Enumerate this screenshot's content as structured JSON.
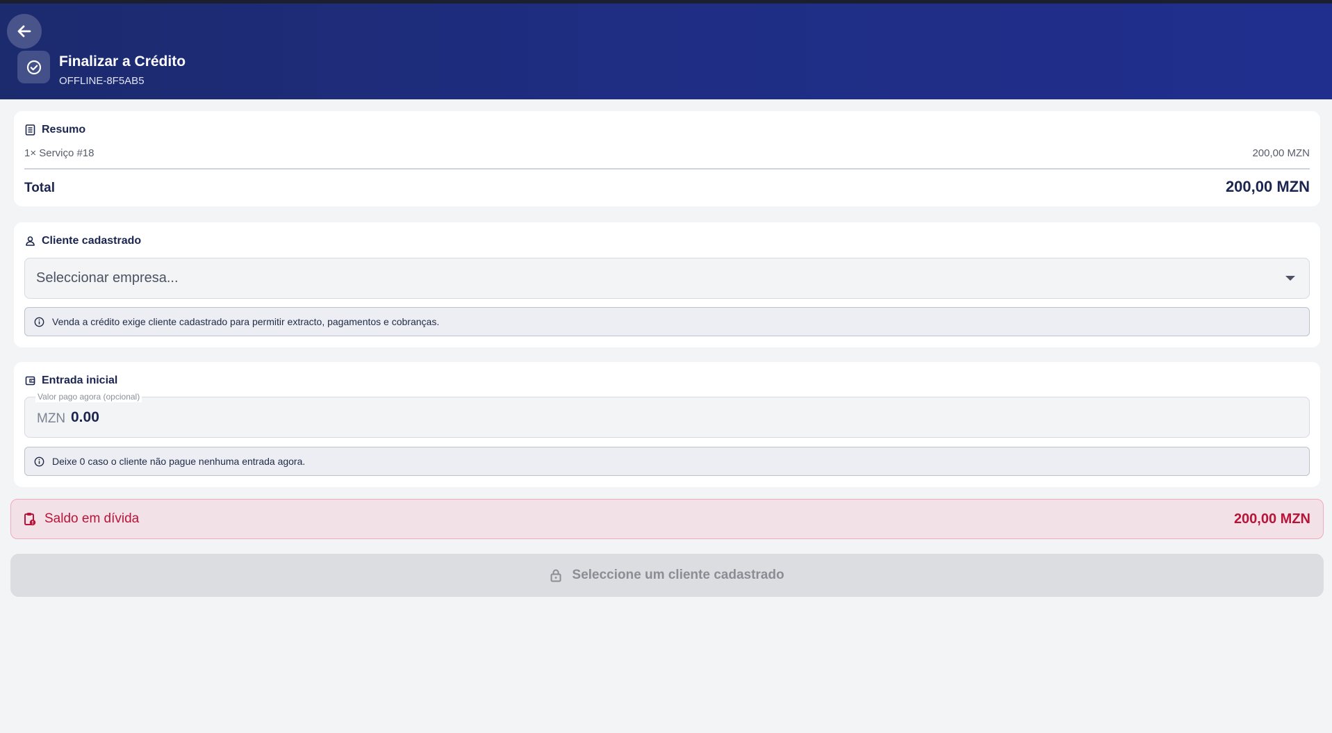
{
  "header": {
    "title": "Finalizar a Crédito",
    "subtitle": "OFFLINE-8F5AB5",
    "back_icon": "arrow-left-icon",
    "title_icon": "check-circle-icon",
    "gradient_start": "#1c2a6e",
    "gradient_end": "#202f8e"
  },
  "summary": {
    "title": "Resumo",
    "icon": "receipt-icon",
    "items": [
      {
        "label": "1× Serviço #18",
        "amount": "200,00 MZN"
      }
    ],
    "total_label": "Total",
    "total_value": "200,00 MZN"
  },
  "client": {
    "title": "Cliente cadastrado",
    "icon": "person-icon",
    "select_placeholder": "Seleccionar empresa...",
    "info_text": "Venda a crédito exige cliente cadastrado para permitir extracto, pagamentos e cobranças."
  },
  "down_payment": {
    "title": "Entrada inicial",
    "icon": "wallet-icon",
    "field_label": "Valor pago agora (opcional)",
    "currency_prefix": "MZN",
    "value": "0.00",
    "info_text": "Deixe 0 caso o cliente não pague nenhuma entrada agora."
  },
  "balance": {
    "label": "Saldo em dívida",
    "value": "200,00 MZN",
    "icon": "clipboard-alert-icon",
    "color": "#b8143a"
  },
  "submit": {
    "label": "Seleccione um cliente cadastrado",
    "icon": "lock-icon",
    "disabled": true
  }
}
